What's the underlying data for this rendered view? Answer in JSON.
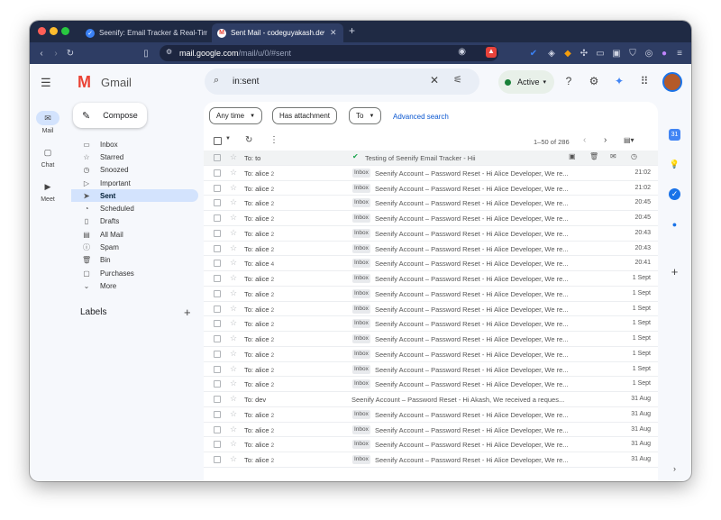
{
  "browser": {
    "tabs": [
      {
        "title": "Seenify: Email Tracker & Real-Time",
        "active": false
      },
      {
        "title": "Sent Mail - codeguyakash.dev",
        "active": true
      }
    ],
    "new_tab": "+",
    "url_host": "mail.google.com",
    "url_path": "/mail/u/0/#sent"
  },
  "gmail": {
    "logo_text": "Gmail",
    "search_query": "in:sent",
    "status": "Active",
    "rail": [
      {
        "label": "Mail",
        "icon": "mail-icon"
      },
      {
        "label": "Chat",
        "icon": "chat-icon"
      },
      {
        "label": "Meet",
        "icon": "meet-icon"
      }
    ],
    "compose_label": "Compose",
    "nav": [
      {
        "label": "Inbox",
        "icon": "inbox-icon",
        "selected": false
      },
      {
        "label": "Starred",
        "icon": "star-icon",
        "selected": false
      },
      {
        "label": "Snoozed",
        "icon": "clock-icon",
        "selected": false
      },
      {
        "label": "Important",
        "icon": "important-icon",
        "selected": false
      },
      {
        "label": "Sent",
        "icon": "send-icon",
        "selected": true
      },
      {
        "label": "Scheduled",
        "icon": "scheduled-icon",
        "selected": false
      },
      {
        "label": "Drafts",
        "icon": "draft-icon",
        "selected": false
      },
      {
        "label": "All Mail",
        "icon": "all-mail-icon",
        "selected": false
      },
      {
        "label": "Spam",
        "icon": "spam-icon",
        "selected": false
      },
      {
        "label": "Bin",
        "icon": "bin-icon",
        "selected": false
      },
      {
        "label": "Purchases",
        "icon": "purchases-icon",
        "selected": false
      },
      {
        "label": "More",
        "icon": "chevron-down-icon",
        "selected": false
      }
    ],
    "labels_heading": "Labels",
    "filters": [
      "Any time",
      "Has attachment",
      "To"
    ],
    "advanced_search": "Advanced search",
    "pagination": "1–50 of 286",
    "rows": [
      {
        "to": "To: to",
        "count": "",
        "label": "",
        "subject": "Testing of Seenify Email Tracker - Hii",
        "date": "",
        "tracked": true
      },
      {
        "to": "To: alice",
        "count": "2",
        "label": "Inbox",
        "subject": "Seenify Account – Password Reset - Hi Alice Developer, We re...",
        "date": "21:02",
        "tracked": false
      },
      {
        "to": "To: alice",
        "count": "2",
        "label": "Inbox",
        "subject": "Seenify Account – Password Reset - Hi Alice Developer, We re...",
        "date": "21:02",
        "tracked": false
      },
      {
        "to": "To: alice",
        "count": "2",
        "label": "Inbox",
        "subject": "Seenify Account – Password Reset - Hi Alice Developer, We re...",
        "date": "20:45",
        "tracked": false
      },
      {
        "to": "To: alice",
        "count": "2",
        "label": "Inbox",
        "subject": "Seenify Account – Password Reset - Hi Alice Developer, We re...",
        "date": "20:45",
        "tracked": false
      },
      {
        "to": "To: alice",
        "count": "2",
        "label": "Inbox",
        "subject": "Seenify Account – Password Reset - Hi Alice Developer, We re...",
        "date": "20:43",
        "tracked": false
      },
      {
        "to": "To: alice",
        "count": "2",
        "label": "Inbox",
        "subject": "Seenify Account – Password Reset - Hi Alice Developer, We re...",
        "date": "20:43",
        "tracked": false
      },
      {
        "to": "To: alice",
        "count": "4",
        "label": "Inbox",
        "subject": "Seenify Account – Password Reset - Hi Alice Developer, We re...",
        "date": "20:41",
        "tracked": false
      },
      {
        "to": "To: alice",
        "count": "2",
        "label": "Inbox",
        "subject": "Seenify Account – Password Reset - Hi Alice Developer, We re...",
        "date": "1 Sept",
        "tracked": false
      },
      {
        "to": "To: alice",
        "count": "2",
        "label": "Inbox",
        "subject": "Seenify Account – Password Reset - Hi Alice Developer, We re...",
        "date": "1 Sept",
        "tracked": false
      },
      {
        "to": "To: alice",
        "count": "2",
        "label": "Inbox",
        "subject": "Seenify Account – Password Reset - Hi Alice Developer, We re...",
        "date": "1 Sept",
        "tracked": false
      },
      {
        "to": "To: alice",
        "count": "2",
        "label": "Inbox",
        "subject": "Seenify Account – Password Reset - Hi Alice Developer, We re...",
        "date": "1 Sept",
        "tracked": false
      },
      {
        "to": "To: alice",
        "count": "2",
        "label": "Inbox",
        "subject": "Seenify Account – Password Reset - Hi Alice Developer, We re...",
        "date": "1 Sept",
        "tracked": false
      },
      {
        "to": "To: alice",
        "count": "2",
        "label": "Inbox",
        "subject": "Seenify Account – Password Reset - Hi Alice Developer, We re...",
        "date": "1 Sept",
        "tracked": false
      },
      {
        "to": "To: alice",
        "count": "2",
        "label": "Inbox",
        "subject": "Seenify Account – Password Reset - Hi Alice Developer, We re...",
        "date": "1 Sept",
        "tracked": false
      },
      {
        "to": "To: alice",
        "count": "2",
        "label": "Inbox",
        "subject": "Seenify Account – Password Reset - Hi Alice Developer, We re...",
        "date": "1 Sept",
        "tracked": false
      },
      {
        "to": "To: dev",
        "count": "",
        "label": "",
        "subject": "Seenify Account – Password Reset - Hi Akash, We received a reques...",
        "date": "31 Aug",
        "tracked": false
      },
      {
        "to": "To: alice",
        "count": "2",
        "label": "Inbox",
        "subject": "Seenify Account – Password Reset - Hi Alice Developer, We re...",
        "date": "31 Aug",
        "tracked": false
      },
      {
        "to": "To: alice",
        "count": "2",
        "label": "Inbox",
        "subject": "Seenify Account – Password Reset - Hi Alice Developer, We re...",
        "date": "31 Aug",
        "tracked": false
      },
      {
        "to": "To: alice",
        "count": "2",
        "label": "Inbox",
        "subject": "Seenify Account – Password Reset - Hi Alice Developer, We re...",
        "date": "31 Aug",
        "tracked": false
      },
      {
        "to": "To: alice",
        "count": "2",
        "label": "Inbox",
        "subject": "Seenify Account – Password Reset - Hi Alice Developer, We re...",
        "date": "31 Aug",
        "tracked": false
      }
    ]
  },
  "colors": {
    "accent": "#0b57d0",
    "sent_highlight": "#d3e3fd",
    "active_green": "#188038",
    "gmail_red": "#ea4335"
  }
}
